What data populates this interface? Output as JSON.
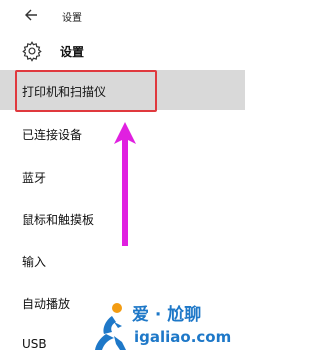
{
  "window": {
    "title": "设置",
    "back_icon": "back-arrow-icon"
  },
  "header": {
    "icon": "gear-icon",
    "title": "设置"
  },
  "nav": {
    "items": [
      {
        "label": "打印机和扫描仪",
        "selected": true
      },
      {
        "label": "已连接设备",
        "selected": false
      },
      {
        "label": "蓝牙",
        "selected": false
      },
      {
        "label": "鼠标和触摸板",
        "selected": false
      },
      {
        "label": "输入",
        "selected": false
      },
      {
        "label": "自动播放",
        "selected": false
      },
      {
        "label": "USB",
        "selected": false
      }
    ]
  },
  "annotations": {
    "highlight_color": "#e0393e",
    "arrow_color": "#e020e0"
  },
  "watermark": {
    "brand_cn": "爱 · 尬聊",
    "url": "igaliao.com",
    "color": "#1e78c8"
  }
}
